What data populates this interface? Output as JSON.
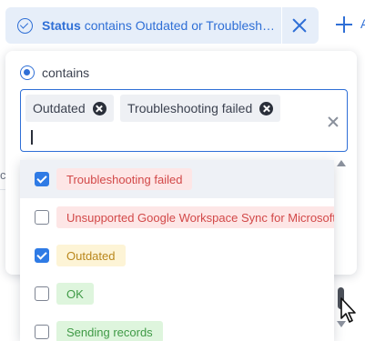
{
  "filter": {
    "field": "Status",
    "condition_text": "contains Outdated or Troublesh…"
  },
  "popover": {
    "operator_label": "contains",
    "selected_tags": [
      "Outdated",
      "Troubleshooting failed"
    ]
  },
  "options": [
    {
      "label": "Troubleshooting failed",
      "checked": true,
      "color": "red"
    },
    {
      "label": "Unsupported Google Workspace Sync for Microsoft Outlook",
      "checked": false,
      "color": "red"
    },
    {
      "label": "Outdated",
      "checked": true,
      "color": "yellow"
    },
    {
      "label": "OK",
      "checked": false,
      "color": "green"
    },
    {
      "label": "Sending records",
      "checked": false,
      "color": "green"
    }
  ],
  "colors": {
    "accent": "#2f6fd6",
    "chip_bg": "#e6eef9",
    "red_text": "#d24848",
    "yellow_text": "#b9871c",
    "green_text": "#3f9a46"
  }
}
